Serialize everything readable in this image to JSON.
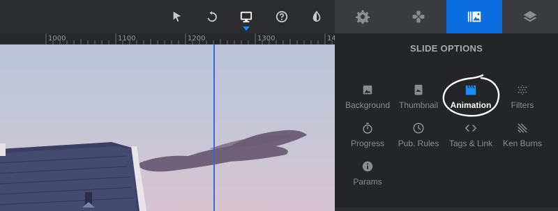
{
  "toolbar": {
    "icons": [
      "cursor-icon",
      "undo-icon",
      "desktop-icon",
      "help-icon",
      "contrast-icon"
    ],
    "active": "desktop-icon"
  },
  "ruler": {
    "labels": [
      "1000",
      "1100",
      "1200",
      "1300",
      "14"
    ]
  },
  "panel": {
    "tabs": [
      "gear-icon",
      "gamepad-icon",
      "slides-icon",
      "layers-icon"
    ],
    "active_tab": "slides-icon",
    "title": "SLIDE OPTIONS",
    "options": [
      {
        "label": "Background",
        "icon": "image-icon"
      },
      {
        "label": "Thumbnail",
        "icon": "thumbnail-icon"
      },
      {
        "label": "Animation",
        "icon": "clapper-icon",
        "active": true
      },
      {
        "label": "Filters",
        "icon": "filters-icon"
      },
      {
        "label": "Progress",
        "icon": "stopwatch-icon"
      },
      {
        "label": "Pub. Rules",
        "icon": "clock-icon"
      },
      {
        "label": "Tags & Link",
        "icon": "code-icon"
      },
      {
        "label": "Ken Burns",
        "icon": "kenburns-icon"
      },
      {
        "label": "Params",
        "icon": "info-icon"
      }
    ]
  },
  "colors": {
    "accent": "#0b6ddf",
    "guide": "#2b6fd6",
    "panel_bg": "#242528"
  }
}
